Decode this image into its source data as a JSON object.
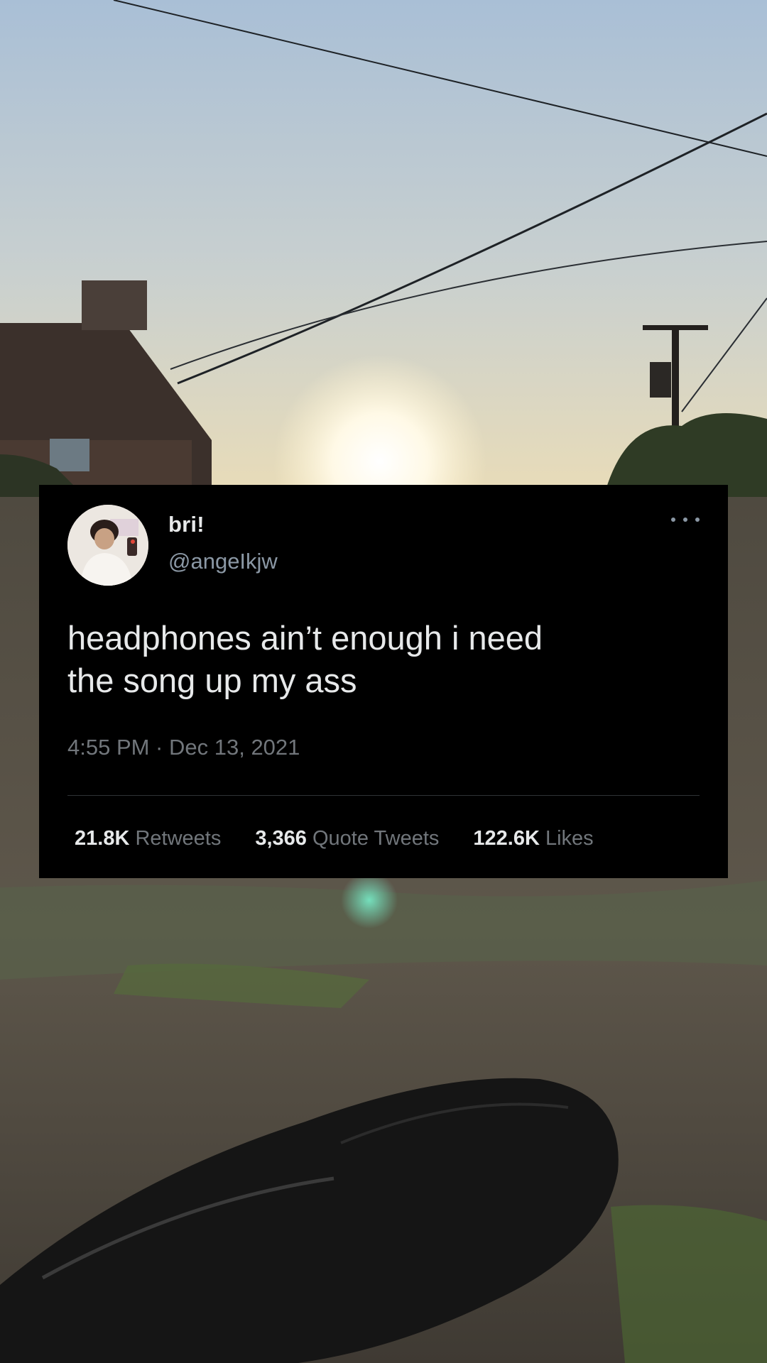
{
  "tweet": {
    "display_name": "bri!",
    "handle": "@angeIkjw",
    "text": "headphones ain’t enough i need\nthe song up my ass",
    "timestamp": "4:55 PM · Dec 13, 2021",
    "stats": [
      {
        "count": "21.8K",
        "label": "Retweets"
      },
      {
        "count": "3,366",
        "label": "Quote Tweets"
      },
      {
        "count": "122.6K",
        "label": "Likes"
      }
    ],
    "more_icon": "more-horizontal-icon"
  },
  "colors": {
    "card_background": "#000000",
    "primary_text": "#e7e9ea",
    "secondary_text": "#71767b",
    "divider": "#2f3336"
  }
}
